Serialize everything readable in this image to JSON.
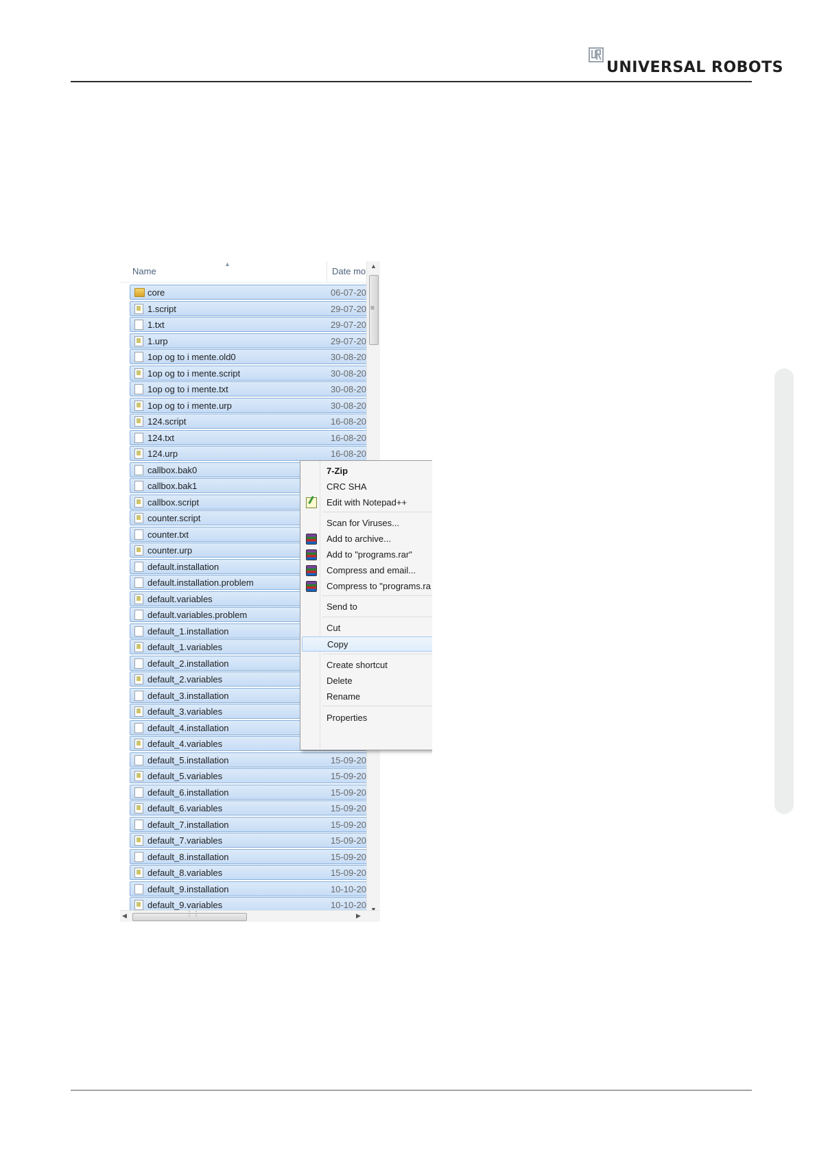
{
  "header": {
    "brand": "UNIVERSAL ROBOTS"
  },
  "explorer": {
    "columns": {
      "name": "Name",
      "date": "Date mo"
    },
    "files": [
      {
        "name": "core",
        "date": "06-07-20",
        "icon": "folder-icon"
      },
      {
        "name": "1.script",
        "date": "29-07-20",
        "icon": "script-file-icon"
      },
      {
        "name": "1.txt",
        "date": "29-07-20",
        "icon": "file-icon"
      },
      {
        "name": "1.urp",
        "date": "29-07-20",
        "icon": "script-file-icon"
      },
      {
        "name": "1op og to i mente.old0",
        "date": "30-08-20",
        "icon": "file-icon"
      },
      {
        "name": "1op og to i mente.script",
        "date": "30-08-20",
        "icon": "script-file-icon"
      },
      {
        "name": "1op og to i mente.txt",
        "date": "30-08-20",
        "icon": "file-icon"
      },
      {
        "name": "1op og to i mente.urp",
        "date": "30-08-20",
        "icon": "script-file-icon"
      },
      {
        "name": "124.script",
        "date": "16-08-20",
        "icon": "script-file-icon"
      },
      {
        "name": "124.txt",
        "date": "16-08-20",
        "icon": "file-icon"
      },
      {
        "name": "124.urp",
        "date": "16-08-20",
        "icon": "script-file-icon"
      },
      {
        "name": "callbox.bak0",
        "date": "",
        "icon": "file-icon"
      },
      {
        "name": "callbox.bak1",
        "date": "",
        "icon": "file-icon"
      },
      {
        "name": "callbox.script",
        "date": "",
        "icon": "script-file-icon"
      },
      {
        "name": "counter.script",
        "date": "",
        "icon": "script-file-icon"
      },
      {
        "name": "counter.txt",
        "date": "",
        "icon": "file-icon"
      },
      {
        "name": "counter.urp",
        "date": "",
        "icon": "script-file-icon"
      },
      {
        "name": "default.installation",
        "date": "",
        "icon": "file-icon"
      },
      {
        "name": "default.installation.problem",
        "date": "",
        "icon": "file-icon"
      },
      {
        "name": "default.variables",
        "date": "",
        "icon": "script-file-icon"
      },
      {
        "name": "default.variables.problem",
        "date": "",
        "icon": "file-icon"
      },
      {
        "name": "default_1.installation",
        "date": "",
        "icon": "file-icon"
      },
      {
        "name": "default_1.variables",
        "date": "",
        "icon": "script-file-icon"
      },
      {
        "name": "default_2.installation",
        "date": "",
        "icon": "file-icon"
      },
      {
        "name": "default_2.variables",
        "date": "",
        "icon": "script-file-icon"
      },
      {
        "name": "default_3.installation",
        "date": "",
        "icon": "file-icon"
      },
      {
        "name": "default_3.variables",
        "date": "",
        "icon": "script-file-icon"
      },
      {
        "name": "default_4.installation",
        "date": "",
        "icon": "file-icon"
      },
      {
        "name": "default_4.variables",
        "date": "",
        "icon": "script-file-icon"
      },
      {
        "name": "default_5.installation",
        "date": "15-09-20",
        "icon": "file-icon"
      },
      {
        "name": "default_5.variables",
        "date": "15-09-20",
        "icon": "script-file-icon"
      },
      {
        "name": "default_6.installation",
        "date": "15-09-20",
        "icon": "file-icon"
      },
      {
        "name": "default_6.variables",
        "date": "15-09-20",
        "icon": "script-file-icon"
      },
      {
        "name": "default_7.installation",
        "date": "15-09-20",
        "icon": "file-icon"
      },
      {
        "name": "default_7.variables",
        "date": "15-09-20",
        "icon": "script-file-icon"
      },
      {
        "name": "default_8.installation",
        "date": "15-09-20",
        "icon": "file-icon"
      },
      {
        "name": "default_8.variables",
        "date": "15-09-20",
        "icon": "script-file-icon"
      },
      {
        "name": "default_9.installation",
        "date": "10-10-20",
        "icon": "file-icon"
      },
      {
        "name": "default_9.variables",
        "date": "10-10-20",
        "icon": "script-file-icon"
      }
    ]
  },
  "context_menu": {
    "items": [
      {
        "label": "7-Zip",
        "bold": true,
        "icon": ""
      },
      {
        "label": "CRC SHA",
        "icon": ""
      },
      {
        "label": "Edit with Notepad++",
        "icon": "notepad-plus-plus-icon"
      },
      {
        "label": "Scan for Viruses...",
        "icon": ""
      },
      {
        "label": "Add to archive...",
        "icon": "winrar-icon"
      },
      {
        "label": "Add to \"programs.rar\"",
        "icon": "winrar-icon"
      },
      {
        "label": "Compress and email...",
        "icon": "winrar-icon"
      },
      {
        "label": "Compress to \"programs.ra",
        "icon": "winrar-icon"
      },
      {
        "label": "Send to",
        "icon": ""
      },
      {
        "label": "Cut",
        "icon": ""
      },
      {
        "label": "Copy",
        "icon": "",
        "highlighted": true
      },
      {
        "label": "Create shortcut",
        "icon": ""
      },
      {
        "label": "Delete",
        "icon": ""
      },
      {
        "label": "Rename",
        "icon": ""
      },
      {
        "label": "Properties",
        "icon": ""
      }
    ]
  },
  "colors": {
    "selection": "#cde1f7",
    "selection_border": "#89b0db",
    "menu_bg": "#f5f5f5"
  }
}
